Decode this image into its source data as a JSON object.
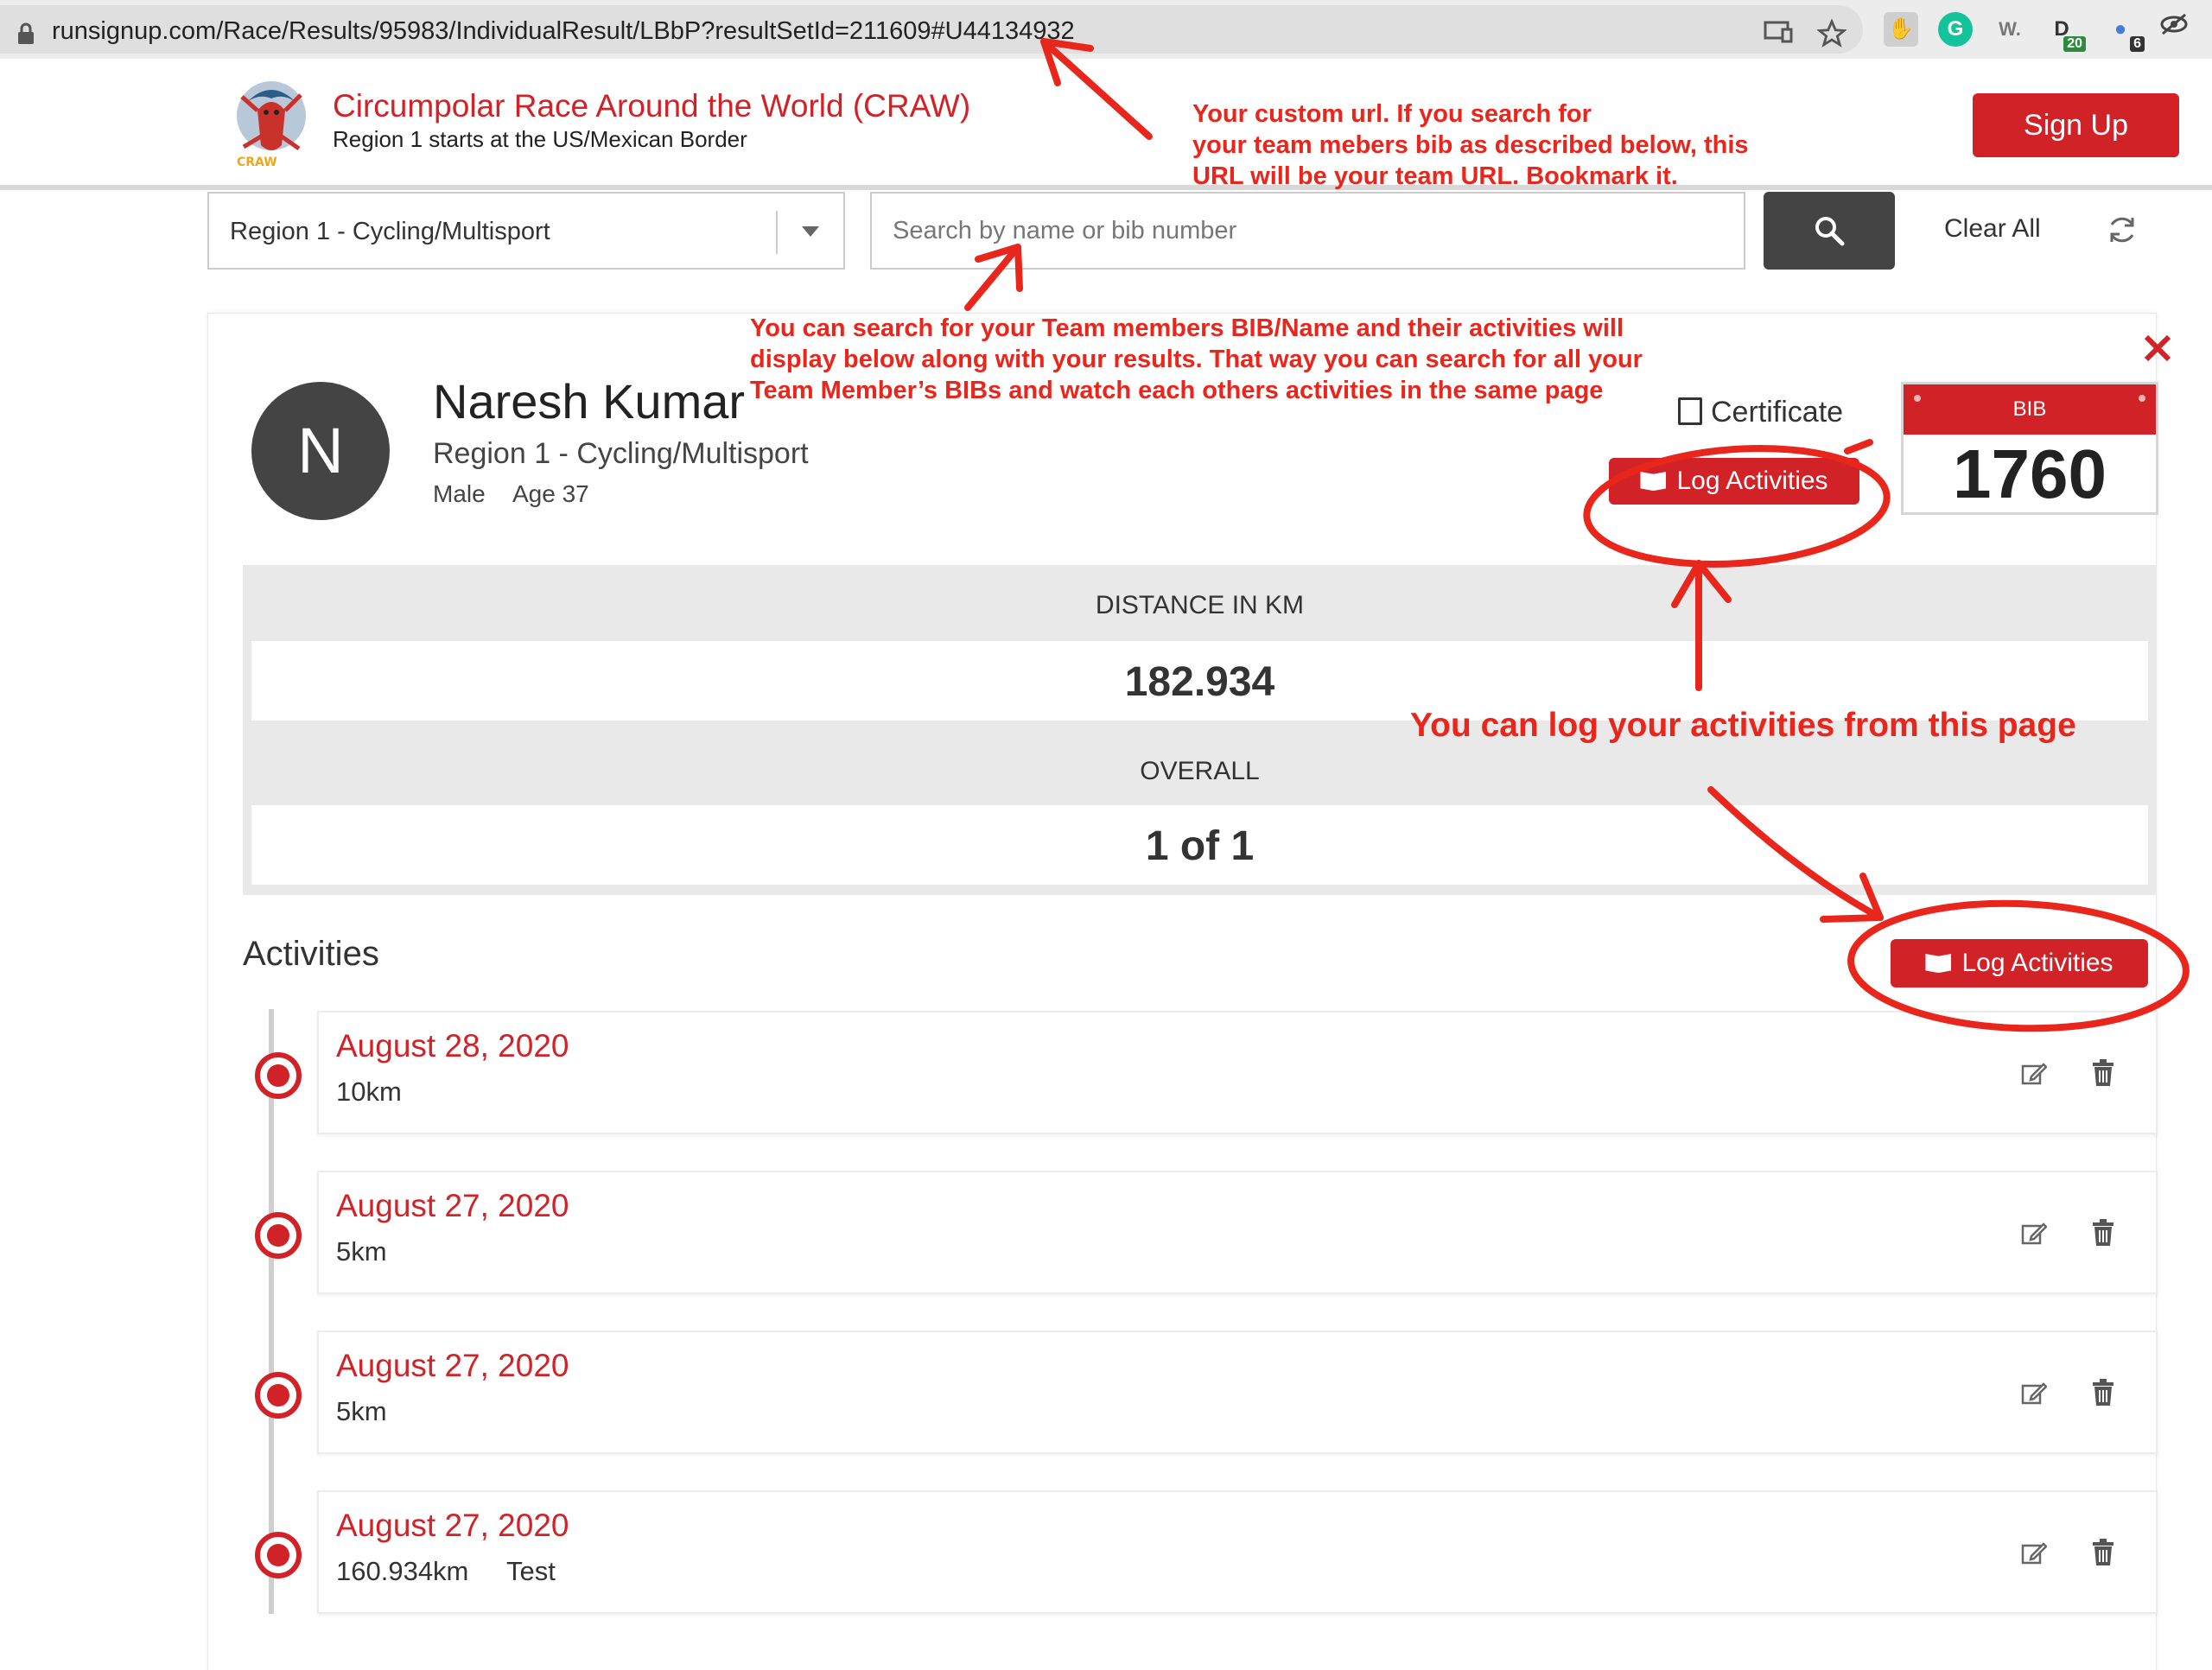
{
  "browser": {
    "url": "runsignup.com/Race/Results/95983/IndividualResult/LBbP?resultSetId=211609#U44134932",
    "extensions": [
      {
        "icon": "hand-icon",
        "label": "",
        "badge": ""
      },
      {
        "icon": "grammarly-icon",
        "label": "G",
        "badge": ""
      },
      {
        "icon": "wordtune-icon",
        "label": "W.",
        "badge": ""
      },
      {
        "icon": "d-extension-icon",
        "label": "D",
        "badge": "20"
      },
      {
        "icon": "lock-extension-icon",
        "label": "",
        "badge": "6"
      },
      {
        "icon": "eye-slash-icon",
        "label": "",
        "badge": ""
      }
    ]
  },
  "header": {
    "race_title": "Circumpolar Race Around the World (CRAW)",
    "race_subtitle": "Region 1 starts at the US/Mexican Border",
    "logo_text": "CRAW",
    "signup_label": "Sign Up"
  },
  "filters": {
    "division_selected": "Region 1 - Cycling/Multisport",
    "search_placeholder": "Search by name or bib number",
    "clear_all_label": "Clear All"
  },
  "participant": {
    "initial": "N",
    "name": "Naresh Kumar",
    "division": "Region 1 - Cycling/Multisport",
    "gender": "Male",
    "age": "Age 37",
    "certificate_label": "Certificate",
    "log_activities_label": "Log Activities",
    "bib_label": "BIB",
    "bib_number": "1760"
  },
  "stats": [
    {
      "label": "DISTANCE IN KM",
      "value": "182.934"
    },
    {
      "label": "OVERALL",
      "value": "1 of 1"
    }
  ],
  "activities": {
    "title": "Activities",
    "log_activities_label": "Log Activities",
    "items": [
      {
        "date": "August 28, 2020",
        "distance": "10km",
        "note": ""
      },
      {
        "date": "August 27, 2020",
        "distance": "5km",
        "note": ""
      },
      {
        "date": "August 27, 2020",
        "distance": "5km",
        "note": ""
      },
      {
        "date": "August 27, 2020",
        "distance": "160.934km",
        "note": "Test"
      }
    ]
  },
  "annotations": {
    "url_note": [
      "Your custom url. If you search for",
      "your team mebers bib as described below, this",
      "URL will be your team URL. Bookmark it."
    ],
    "search_note": [
      "You can search for your Team members BIB/Name and their activities will",
      "display below along with your results. That way you can search for all your",
      "Team Member’s BIBs and watch each others activities in the same page"
    ],
    "log_note": "You can log your activities from this page",
    "color": "#e8261c"
  },
  "colors": {
    "brand_red": "#d12228",
    "dark_button": "#444444"
  }
}
